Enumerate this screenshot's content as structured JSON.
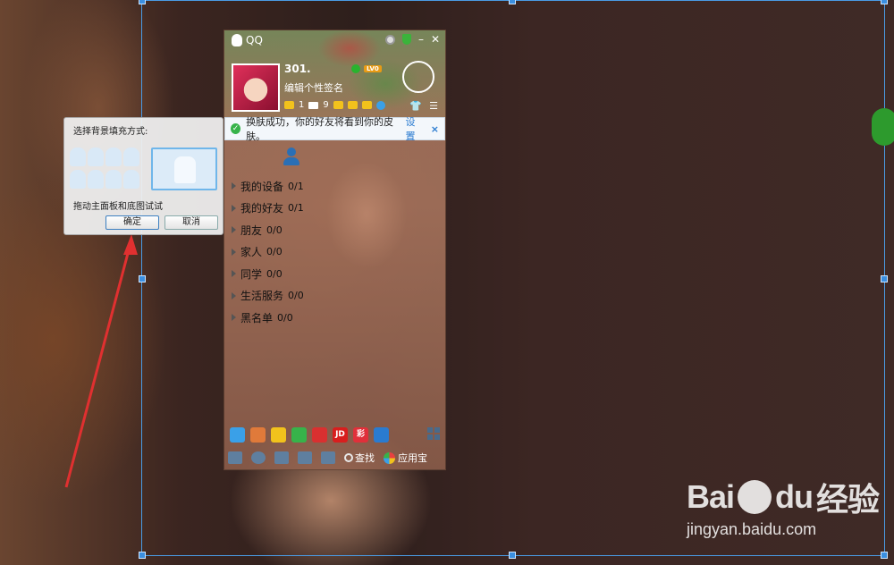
{
  "qq": {
    "title": "QQ",
    "nickname": "301.",
    "signature": "编辑个性签名",
    "level": "LV0",
    "star_count": "1",
    "mail_count": "9",
    "notice": {
      "text": "换肤成功，你的好友将看到你的皮肤。",
      "link": "设置",
      "close": "×"
    },
    "groups": [
      {
        "label": "我的设备",
        "count": "0/1"
      },
      {
        "label": "我的好友",
        "count": "0/1"
      },
      {
        "label": "朋友",
        "count": "0/0"
      },
      {
        "label": "家人",
        "count": "0/0"
      },
      {
        "label": "同学",
        "count": "0/0"
      },
      {
        "label": "生活服务",
        "count": "0/0"
      },
      {
        "label": "黑名单",
        "count": "0/0"
      }
    ],
    "apps": [
      {
        "name": "weather-app-icon",
        "text": "",
        "color": "#3aa0e8"
      },
      {
        "name": "photo-app-icon",
        "text": "",
        "color": "#e07a3a"
      },
      {
        "name": "music-app-icon",
        "text": "",
        "color": "#f2c21c"
      },
      {
        "name": "video-app-icon",
        "text": "",
        "color": "#37b34a"
      },
      {
        "name": "stock-app-icon",
        "text": "",
        "color": "#d93030"
      },
      {
        "name": "jd-app-icon",
        "text": "JD",
        "color": "#d81e1e"
      },
      {
        "name": "lottery-app-icon",
        "text": "彩",
        "color": "#e0303a"
      },
      {
        "name": "security-app-icon",
        "text": "",
        "color": "#2a7bd0"
      }
    ],
    "toolbar": {
      "find_label": "查找",
      "store_label": "应用宝"
    }
  },
  "dialog": {
    "title": "选择背景填充方式:",
    "hint": "拖动主面板和底图试试",
    "ok_label": "确定",
    "cancel_label": "取消"
  },
  "watermark": {
    "brand": "Bai",
    "brand2": "du",
    "brand3": "经验",
    "url": "jingyan.baidu.com"
  },
  "colors": {
    "selection": "#4a9be4",
    "arrow": "#e03030",
    "notice_link": "#2a7bd0"
  }
}
